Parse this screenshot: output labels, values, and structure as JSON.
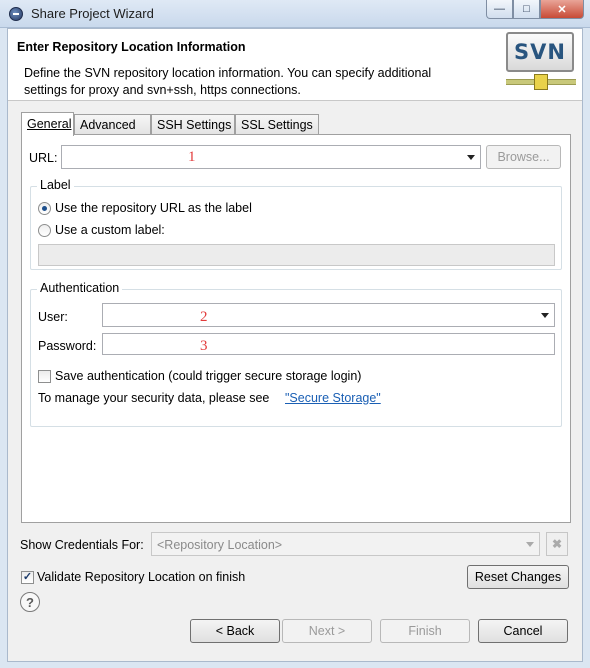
{
  "window": {
    "title": "Share Project Wizard",
    "minimize_icon": "minimize-icon",
    "maximize_icon": "maximize-icon",
    "close_icon": "close-icon"
  },
  "header": {
    "title": "Enter Repository Location Information",
    "description": "Define the SVN repository location information. You can specify additional settings for proxy and svn+ssh, https connections.",
    "logo_text": "SVN"
  },
  "tabs": [
    {
      "label": "General",
      "active": true
    },
    {
      "label": "Advanced",
      "active": false
    },
    {
      "label": "SSH Settings",
      "active": false
    },
    {
      "label": "SSL Settings",
      "active": false
    }
  ],
  "general": {
    "url_label": "URL:",
    "url_value": "",
    "browse_label": "Browse...",
    "annotation_1": "1",
    "label_group_title": "Label",
    "radio_use_url": "Use the repository URL as the label",
    "radio_custom": "Use a custom label:",
    "custom_label_value": "",
    "auth_group_title": "Authentication",
    "user_label": "User:",
    "user_value": "",
    "annotation_2": "2",
    "password_label": "Password:",
    "password_value": "",
    "annotation_3": "3",
    "save_auth_label": "Save authentication (could trigger secure storage login)",
    "save_auth_checked": false,
    "manage_text": "To manage your security data, please see ",
    "secure_storage_link": "\"Secure Storage\""
  },
  "footer": {
    "show_credentials_label": "Show Credentials For:",
    "credentials_value": "<Repository Location>",
    "validate_label": "Validate Repository Location on finish",
    "validate_checked": true,
    "reset_changes_label": "Reset Changes",
    "back_label": "< Back",
    "next_label": "Next >",
    "finish_label": "Finish",
    "cancel_label": "Cancel"
  },
  "colors": {
    "annotation": "#e23b3b",
    "link": "#1a5fb4",
    "logo_text": "#29557f"
  }
}
